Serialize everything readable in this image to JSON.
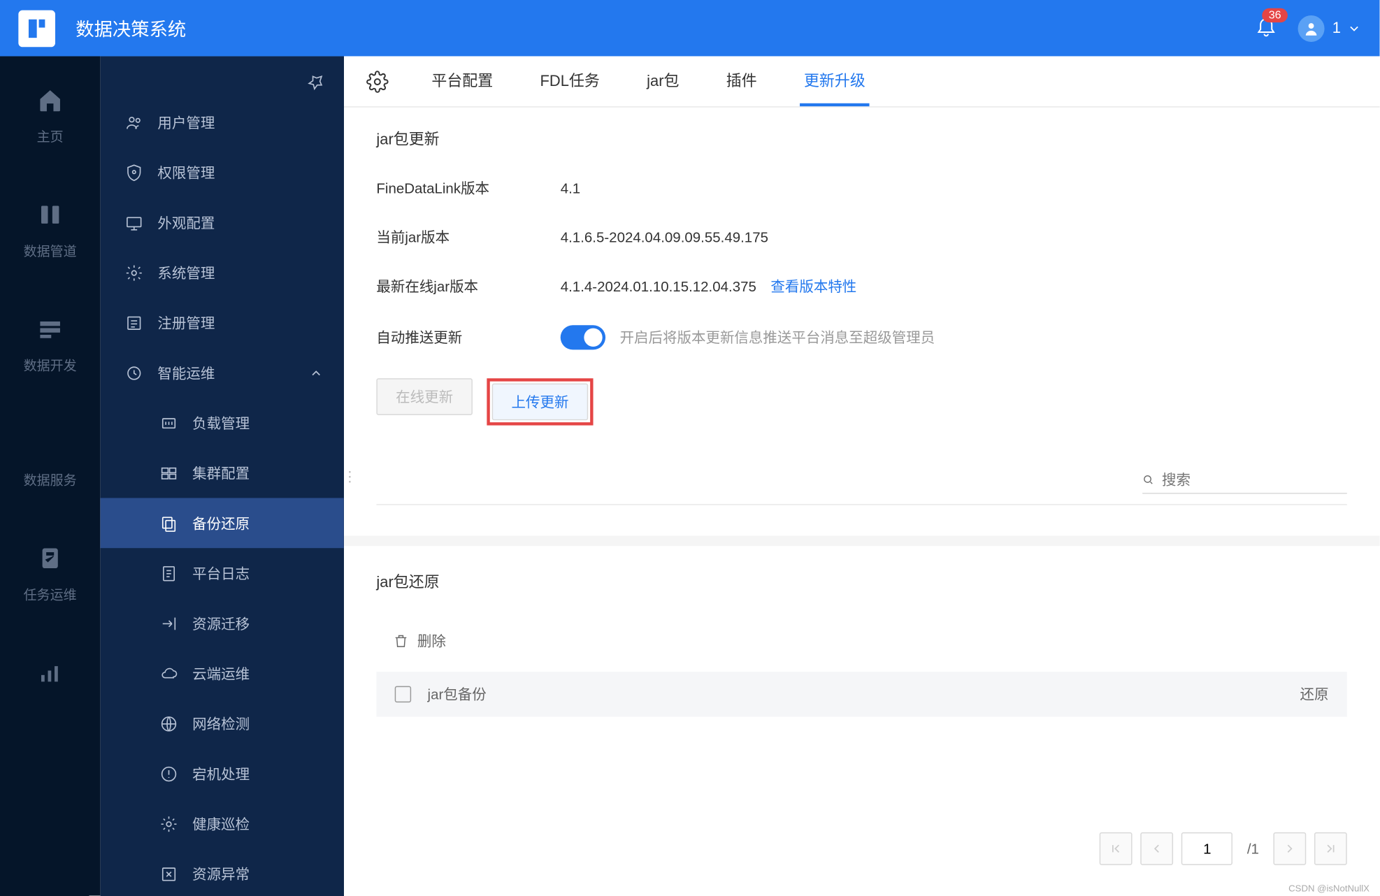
{
  "header": {
    "title": "数据决策系统",
    "badge": "36",
    "username": "1"
  },
  "rail": [
    {
      "label": "主页"
    },
    {
      "label": "数据管道"
    },
    {
      "label": "数据开发"
    },
    {
      "label": "数据服务"
    },
    {
      "label": "任务运维"
    }
  ],
  "sidebar": {
    "items": [
      {
        "label": "用户管理"
      },
      {
        "label": "权限管理"
      },
      {
        "label": "外观配置"
      },
      {
        "label": "系统管理"
      },
      {
        "label": "注册管理"
      },
      {
        "label": "智能运维",
        "expanded": true
      },
      {
        "label": "负载管理",
        "child": true
      },
      {
        "label": "集群配置",
        "child": true
      },
      {
        "label": "备份还原",
        "child": true,
        "active": true
      },
      {
        "label": "平台日志",
        "child": true
      },
      {
        "label": "资源迁移",
        "child": true
      },
      {
        "label": "云端运维",
        "child": true
      },
      {
        "label": "网络检测",
        "child": true
      },
      {
        "label": "宕机处理",
        "child": true
      },
      {
        "label": "健康巡检",
        "child": true
      },
      {
        "label": "资源异常",
        "child": true
      }
    ]
  },
  "tabs": [
    "平台配置",
    "FDL任务",
    "jar包",
    "插件",
    "更新升级"
  ],
  "active_tab": 4,
  "update": {
    "section_title": "jar包更新",
    "rows": {
      "version_label": "FineDataLink版本",
      "version_value": "4.1",
      "current_label": "当前jar版本",
      "current_value": "4.1.6.5-2024.04.09.09.55.49.175",
      "latest_label": "最新在线jar版本",
      "latest_value": "4.1.4-2024.01.10.15.12.04.375",
      "latest_link": "查看版本特性",
      "push_label": "自动推送更新",
      "push_hint": "开启后将版本更新信息推送平台消息至超级管理员"
    },
    "buttons": {
      "online": "在线更新",
      "upload": "上传更新"
    },
    "search_placeholder": "搜索"
  },
  "restore": {
    "section_title": "jar包还原",
    "delete_label": "删除",
    "col_name": "jar包备份",
    "col_action": "还原"
  },
  "pagination": {
    "current": "1",
    "total": "/1"
  },
  "watermark": "CSDN @isNotNullX"
}
